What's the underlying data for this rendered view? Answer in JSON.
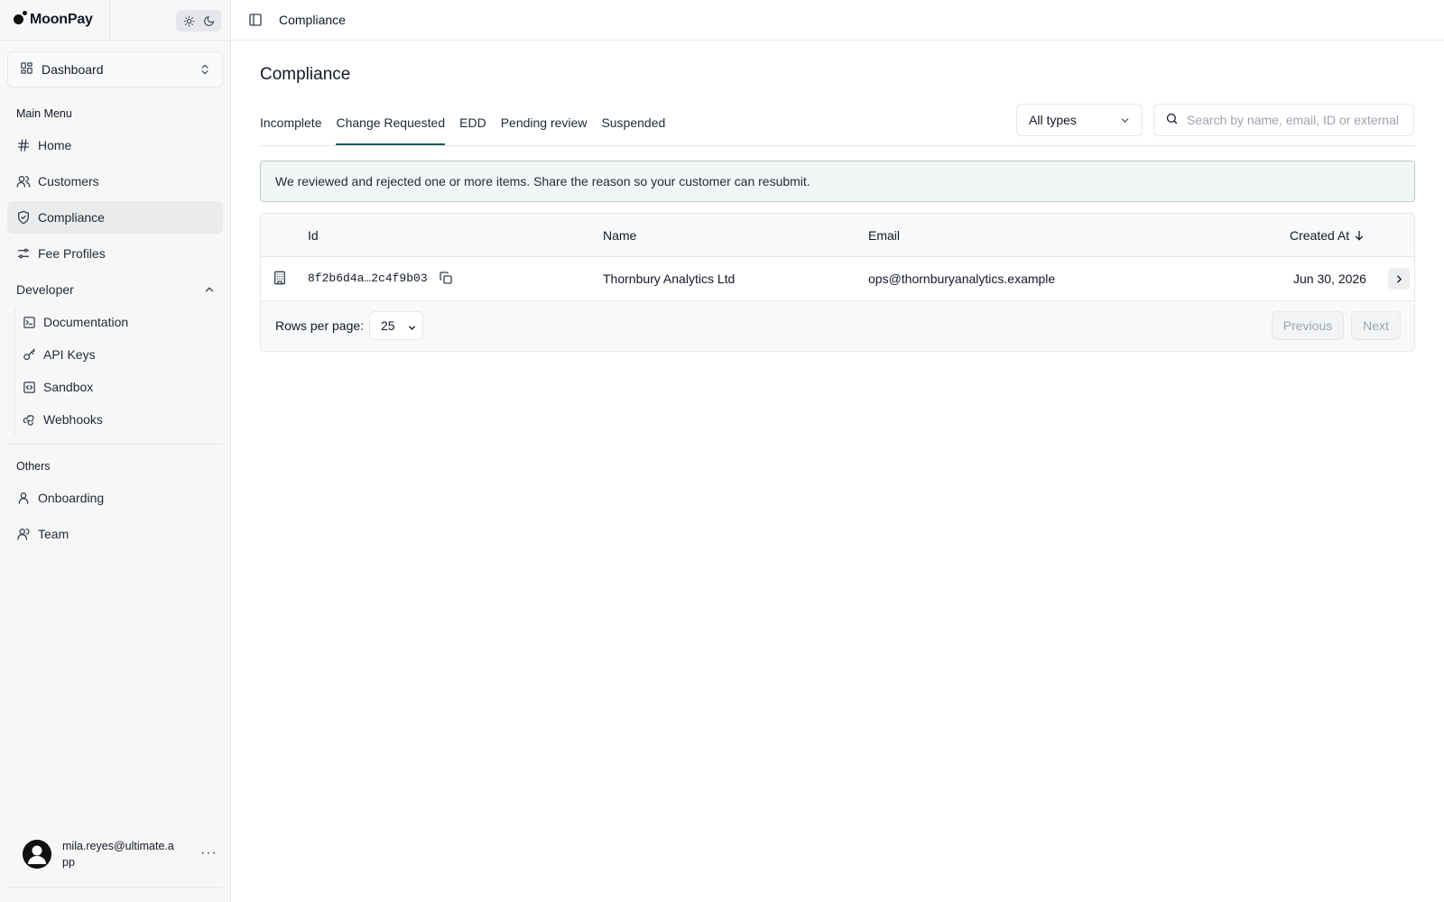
{
  "brand": {
    "name": "MoonPay"
  },
  "theme_toggle": {
    "light_icon": "sun-icon",
    "dark_icon": "moon-icon"
  },
  "workspace_select": {
    "label": "Dashboard",
    "icon": "dashboard-grid-icon"
  },
  "sidebar": {
    "main_menu_title": "Main Menu",
    "main_items": [
      {
        "label": "Home",
        "icon": "hash-icon"
      },
      {
        "label": "Customers",
        "icon": "users-icon"
      },
      {
        "label": "Compliance",
        "icon": "shield-check-icon",
        "active": true
      },
      {
        "label": "Fee Profiles",
        "icon": "sliders-icon"
      }
    ],
    "developer_title": "Developer",
    "developer_items": [
      {
        "label": "Documentation",
        "icon": "terminal-icon"
      },
      {
        "label": "API Keys",
        "icon": "key-icon"
      },
      {
        "label": "Sandbox",
        "icon": "code-box-icon"
      },
      {
        "label": "Webhooks",
        "icon": "webhook-icon"
      }
    ],
    "others_title": "Others",
    "other_items": [
      {
        "label": "Onboarding",
        "icon": "user-icon"
      },
      {
        "label": "Team",
        "icon": "team-icon"
      }
    ],
    "user": {
      "email": "mila.reyes@ultimate.app"
    }
  },
  "header": {
    "breadcrumb": "Compliance"
  },
  "page": {
    "title": "Compliance",
    "tabs": [
      {
        "label": "Incomplete"
      },
      {
        "label": "Change Requested",
        "active": true
      },
      {
        "label": "EDD"
      },
      {
        "label": "Pending review"
      },
      {
        "label": "Suspended"
      }
    ],
    "type_filter": {
      "value": "All types"
    },
    "search": {
      "placeholder": "Search by name, email, ID or external ID"
    },
    "banner": "We reviewed and rejected one or more items. Share the reason so your customer can resubmit."
  },
  "table": {
    "columns": [
      "Id",
      "Name",
      "Email",
      "Created At"
    ],
    "rows": [
      {
        "type_icon": "building-icon",
        "id": "8f2b6d4a…2c4f9b03",
        "name": "Thornbury Analytics Ltd",
        "email": "ops@thornburyanalytics.example",
        "created_at": "Jun 30, 2026"
      }
    ],
    "rows_per_page_label": "Rows per page:",
    "rows_per_page": "25",
    "previous_label": "Previous",
    "next_label": "Next"
  },
  "colors": {
    "accent": "#1f5d63",
    "banner_border": "#b9c9ca",
    "sidebar_bg": "#f7f7f8"
  }
}
